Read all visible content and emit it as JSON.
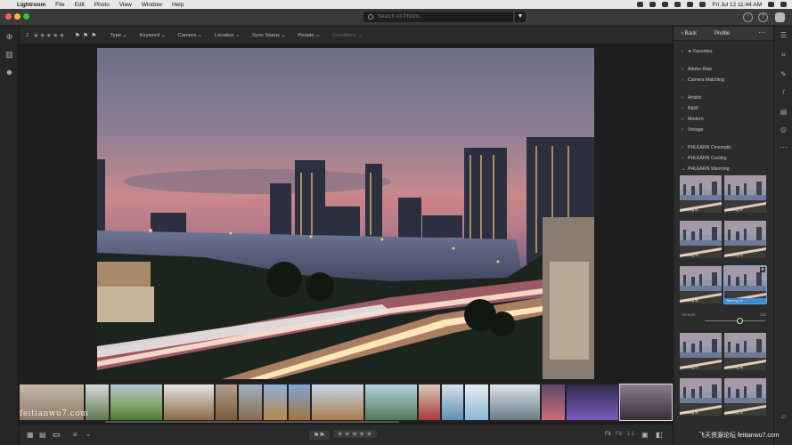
{
  "menubar": {
    "apple": "",
    "app": "Lightroom",
    "items": [
      "File",
      "Edit",
      "Photo",
      "View",
      "Window",
      "Help"
    ],
    "clock": "Fri Jul 12  11:44 AM"
  },
  "titlebar": {
    "search_placeholder": "Search All Photos"
  },
  "filterbar": {
    "count": "2",
    "stars": "★★★★★",
    "flags": "⚑⚑⚑",
    "dropdowns": [
      "Type",
      "Keyword",
      "Camera",
      "Location",
      "Sync Status",
      "People",
      "Conditions"
    ]
  },
  "profile_panel": {
    "back_label": "Back",
    "title": "Profile",
    "more": "···",
    "favorites": "Favorites",
    "groups1": [
      "Adobe Raw",
      "Camera Matching"
    ],
    "groups2": [
      "Artistic",
      "B&W",
      "Modern",
      "Vintage"
    ],
    "groups3": [
      "PHLEARN Cinematic",
      "PHLEARN Cooling",
      "PHLEARN Warming"
    ],
    "thumb_labels": [
      "Warming 01",
      "Warming 02",
      "Warming 03",
      "Warming 04",
      "Warming 05",
      "Warming 06",
      "Warming 07",
      "Warming 08",
      "Warming 09",
      "Warming 10"
    ],
    "selected_index": 5,
    "amount_label": "Amount",
    "amount_value": "116",
    "amount_fraction": 0.58
  },
  "bottombar": {
    "fit": "Fit",
    "fill": "Fill",
    "ratio": "1:1",
    "stars": "★★★★★",
    "flags": "⚑⚑"
  },
  "watermark": {
    "left": "feitianwu7.com",
    "right": "飞天资源论坛 feitianwu7.com"
  },
  "colors": {
    "accent": "#3a8ad3",
    "panel": "#2c2c2c",
    "canvas": "#1e1e1e"
  }
}
